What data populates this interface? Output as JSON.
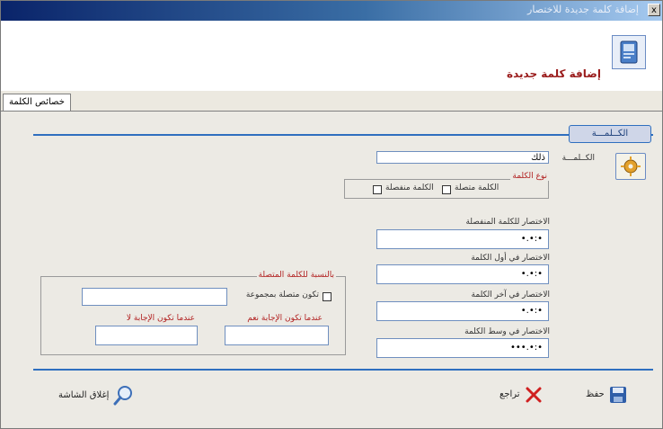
{
  "window": {
    "title": "إضافة كلمة جديدة للاختصار",
    "close_glyph": "x"
  },
  "header": {
    "title": "إضافة كلمة جديدة",
    "icon": "book-icon"
  },
  "tabs": [
    {
      "label": "خصائص الكلمة"
    }
  ],
  "section": {
    "tab_label": "الكــلمـــة"
  },
  "word": {
    "label": "الكــلمـــة",
    "value": "ذلك",
    "icon": "gear-icon"
  },
  "word_type": {
    "legend": "نوع الكلمة",
    "connected_label": "الكلمة متصلة",
    "separated_label": "الكلمة منفصلة",
    "connected_checked": false,
    "separated_checked": false
  },
  "abbreviations": {
    "separated_label": "الاختصار للكلمة المنفصلة",
    "separated_value": "•:•.•",
    "start_label": "الاختصار في أول الكلمة",
    "start_value": "•:•.•",
    "end_label": "الاختصار في آخر الكلمة",
    "end_value": "•:•.•",
    "middle_label": "الاختصار في وسط الكلمة",
    "middle_value": "•:•.•••"
  },
  "connected_group": {
    "legend": "بالنسبة للكلمة المتصلة",
    "group_label": "تكون متصلة بمجموعة",
    "group_checked": false,
    "group_value": "",
    "yes_label": "عندما تكون الإجابة نعم",
    "yes_value": "",
    "no_label": "عندما تكون الإجابة لا",
    "no_value": ""
  },
  "buttons": {
    "save": "حفظ",
    "undo": "تراجع",
    "close_screen": "إغلاق الشاشة"
  },
  "colors": {
    "accent": "#2f6fbf",
    "label_red": "#b22222",
    "header_title": "#9a1b1b"
  }
}
